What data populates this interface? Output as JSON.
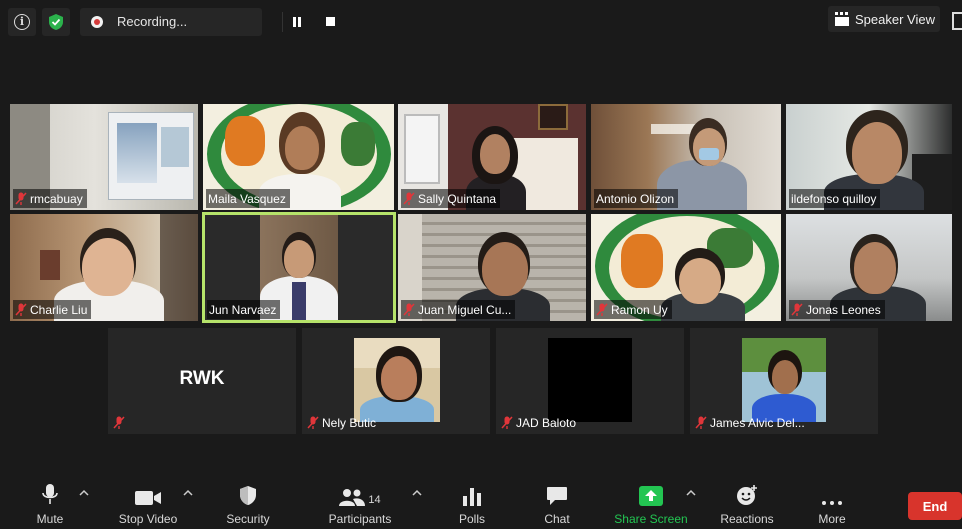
{
  "topbar": {
    "recording_label": "Recording...",
    "view_label": "Speaker View"
  },
  "participants": [
    {
      "name": "rmcabuay"
    },
    {
      "name": "Maila Vasquez"
    },
    {
      "name": "Sally Quintana"
    },
    {
      "name": "Antonio Olizon"
    },
    {
      "name": "ildefonso quilloy"
    },
    {
      "name": "Charlie Liu"
    },
    {
      "name": "Jun Narvaez"
    },
    {
      "name": "Juan Miguel Cu..."
    },
    {
      "name": "Ramon Uy"
    },
    {
      "name": "Jonas Leones"
    },
    {
      "name": "",
      "avatar_text": "RWK"
    },
    {
      "name": "Nely Butic"
    },
    {
      "name": "JAD Baloto"
    },
    {
      "name": "James Alvic Del..."
    }
  ],
  "toolbar": {
    "mute": "Mute",
    "stop_video": "Stop Video",
    "security": "Security",
    "participants": "Participants",
    "participants_count": "14",
    "polls": "Polls",
    "chat": "Chat",
    "share_screen": "Share Screen",
    "reactions": "Reactions",
    "more": "More",
    "end": "End"
  },
  "colors": {
    "active_speaker_border": "#b6e36a",
    "end_button": "#d8342c",
    "share_screen": "#23c552",
    "security_shield": "#2bb24c"
  }
}
